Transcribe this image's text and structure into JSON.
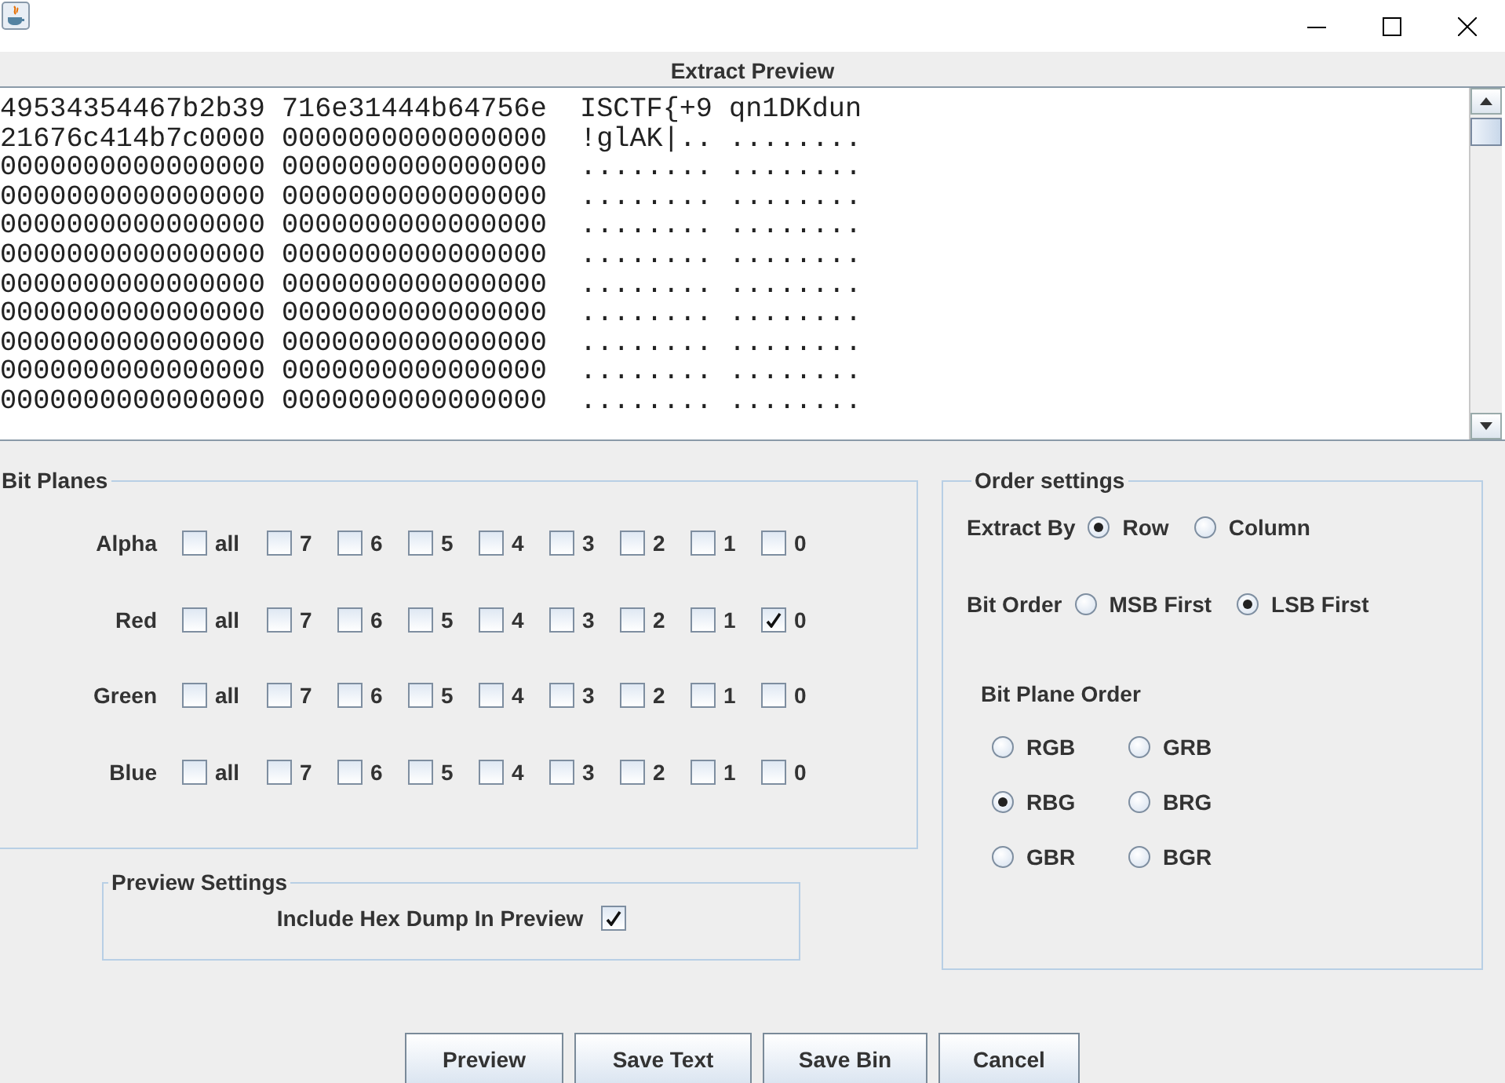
{
  "window": {
    "controls": [
      {
        "kind": "minimize"
      },
      {
        "kind": "maximize"
      },
      {
        "kind": "close"
      }
    ]
  },
  "preview": {
    "title": "Extract Preview",
    "lines": [
      "49534354467b2b39 716e31444b64756e  ISCTF{+9 qn1DKdun",
      "21676c414b7c0000 0000000000000000  !glAK|.. ........",
      "0000000000000000 0000000000000000  ........ ........",
      "0000000000000000 0000000000000000  ........ ........",
      "0000000000000000 0000000000000000  ........ ........",
      "0000000000000000 0000000000000000  ........ ........",
      "0000000000000000 0000000000000000  ........ ........",
      "0000000000000000 0000000000000000  ........ ........",
      "0000000000000000 0000000000000000  ........ ........",
      "0000000000000000 0000000000000000  ........ ........",
      "0000000000000000 0000000000000000  ........ ........"
    ]
  },
  "bit_planes": {
    "title": "Bit Planes",
    "channels": [
      {
        "name": "Alpha",
        "bits": [
          {
            "label": "all",
            "checked": false
          },
          {
            "label": "7",
            "checked": false
          },
          {
            "label": "6",
            "checked": false
          },
          {
            "label": "5",
            "checked": false
          },
          {
            "label": "4",
            "checked": false
          },
          {
            "label": "3",
            "checked": false
          },
          {
            "label": "2",
            "checked": false
          },
          {
            "label": "1",
            "checked": false
          },
          {
            "label": "0",
            "checked": false
          }
        ]
      },
      {
        "name": "Red",
        "bits": [
          {
            "label": "all",
            "checked": false
          },
          {
            "label": "7",
            "checked": false
          },
          {
            "label": "6",
            "checked": false
          },
          {
            "label": "5",
            "checked": false
          },
          {
            "label": "4",
            "checked": false
          },
          {
            "label": "3",
            "checked": false
          },
          {
            "label": "2",
            "checked": false
          },
          {
            "label": "1",
            "checked": false
          },
          {
            "label": "0",
            "checked": true
          }
        ]
      },
      {
        "name": "Green",
        "bits": [
          {
            "label": "all",
            "checked": false
          },
          {
            "label": "7",
            "checked": false
          },
          {
            "label": "6",
            "checked": false
          },
          {
            "label": "5",
            "checked": false
          },
          {
            "label": "4",
            "checked": false
          },
          {
            "label": "3",
            "checked": false
          },
          {
            "label": "2",
            "checked": false
          },
          {
            "label": "1",
            "checked": false
          },
          {
            "label": "0",
            "checked": false
          }
        ]
      },
      {
        "name": "Blue",
        "bits": [
          {
            "label": "all",
            "checked": false
          },
          {
            "label": "7",
            "checked": false
          },
          {
            "label": "6",
            "checked": false
          },
          {
            "label": "5",
            "checked": false
          },
          {
            "label": "4",
            "checked": false
          },
          {
            "label": "3",
            "checked": false
          },
          {
            "label": "2",
            "checked": false
          },
          {
            "label": "1",
            "checked": false
          },
          {
            "label": "0",
            "checked": false
          }
        ]
      }
    ]
  },
  "preview_settings": {
    "title": "Preview Settings",
    "hex_dump": {
      "label": "Include Hex Dump In Preview",
      "checked": true
    }
  },
  "order_settings": {
    "title": "Order settings",
    "extract_by": {
      "label": "Extract By",
      "options": [
        {
          "label": "Row",
          "selected": true
        },
        {
          "label": "Column",
          "selected": false
        }
      ]
    },
    "bit_order": {
      "label": "Bit Order",
      "options": [
        {
          "label": "MSB First",
          "selected": false
        },
        {
          "label": "LSB First",
          "selected": true
        }
      ]
    },
    "bit_plane_order": {
      "label": "Bit Plane Order",
      "options": [
        {
          "label": "RGB",
          "selected": false
        },
        {
          "label": "GRB",
          "selected": false
        },
        {
          "label": "RBG",
          "selected": true
        },
        {
          "label": "BRG",
          "selected": false
        },
        {
          "label": "GBR",
          "selected": false
        },
        {
          "label": "BGR",
          "selected": false
        }
      ]
    }
  },
  "buttons": [
    "Preview",
    "Save Text",
    "Save Bin",
    "Cancel"
  ]
}
